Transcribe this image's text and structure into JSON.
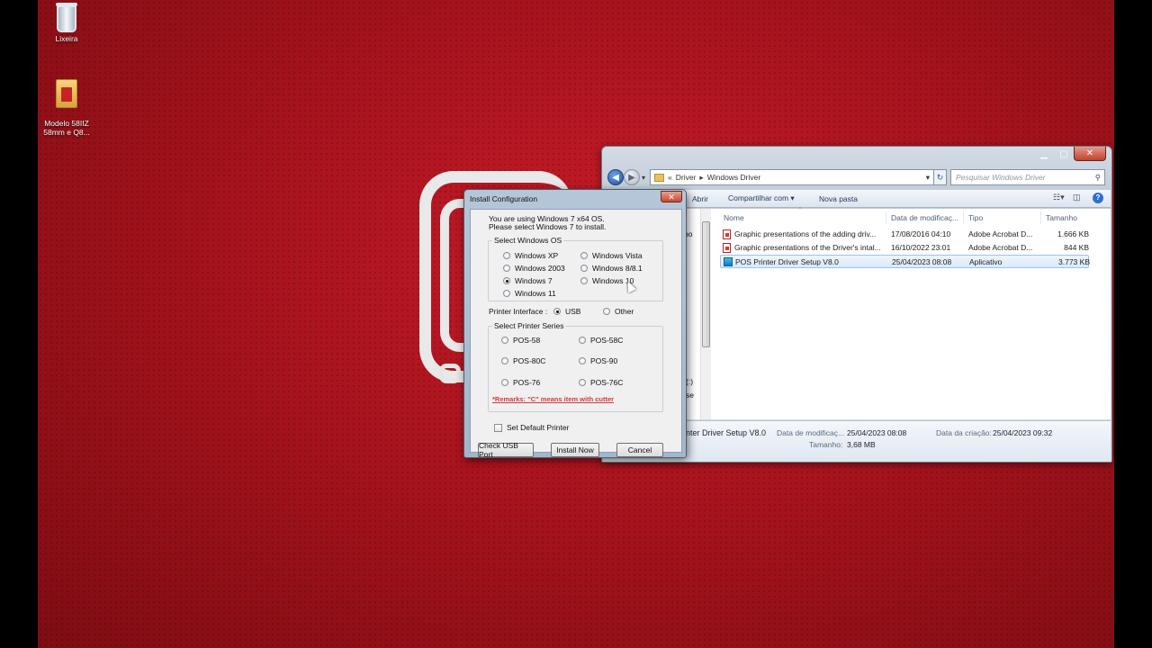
{
  "desktop": {
    "icons": [
      {
        "label": "Lixeira",
        "icon": "recycle-bin-icon"
      },
      {
        "label": "Modelo 58IIZ\n58mm e Q8...",
        "icon": "folder-icon"
      }
    ]
  },
  "explorer": {
    "breadcrumb": {
      "prefix": "«",
      "root": "Driver",
      "sep": "▸",
      "current": "Windows Driver"
    },
    "search_placeholder": "Pesquisar Windows Driver",
    "toolbar": {
      "open": "Abrir",
      "share": "Compartilhar com ▾",
      "new_folder": "Nova pasta",
      "partial_left": "o"
    },
    "columns": {
      "name": "Nome",
      "date": "Data de modificaç...",
      "type": "Tipo",
      "size": "Tamanho"
    },
    "files": [
      {
        "name": "Graphic presentations of the adding driv...",
        "date": "17/08/2016 04:10",
        "type": "Adobe Acrobat D...",
        "size": "1.666 KB",
        "icon": "pdf-icon"
      },
      {
        "name": "Graphic presentations of the Driver's intal...",
        "date": "16/10/2022 23:01",
        "type": "Adobe Acrobat D...",
        "size": "844 KB",
        "icon": "pdf-icon"
      },
      {
        "name": "POS Printer Driver Setup V8.0",
        "date": "25/04/2023 08:08",
        "type": "Aplicativo",
        "size": "3.773 KB",
        "icon": "app-icon"
      }
    ],
    "sidebar_partial": {
      "a": "ho",
      "b": "(:)",
      "c": "se"
    },
    "details": {
      "name": "nter Driver Setup V8.0",
      "mod_label": "Data de modificaç...",
      "mod_value": "25/04/2023 08:08",
      "created_label": "Data da criação:",
      "created_value": "25/04/2023 09:32",
      "size_label": "Tamanho:",
      "size_value": "3,68 MB"
    }
  },
  "dialog": {
    "title": "Install Configuration",
    "close": "✕",
    "info_line1": "You are using Windows 7 x64 OS.",
    "info_line2": "Please select Windows 7 to install.",
    "os_group": "Select Windows OS",
    "os_options": {
      "xp": "Windows XP",
      "vista": "Windows Vista",
      "w2003": "Windows 2003",
      "w8": "Windows 8/8.1",
      "w7": "Windows 7",
      "w10": "Windows 10",
      "w11": "Windows 11"
    },
    "selected_os": "Windows 7",
    "interface_label": "Printer Interface :",
    "interface_usb": "USB",
    "interface_other": "Other",
    "selected_interface": "USB",
    "series_group": "Select Printer Series",
    "series": {
      "p58": "POS-58",
      "p58c": "POS-58C",
      "p80c": "POS-80C",
      "p90": "POS-90",
      "p76": "POS-76",
      "p76c": "POS-76C"
    },
    "remark": "*Remarks: \"C\" means item with cutter",
    "default_printer": "Set Default Printer",
    "default_printer_checked": false,
    "buttons": {
      "check_usb": "Check USB Port",
      "install": "Install Now",
      "cancel": "Cancel"
    }
  },
  "colors": {
    "desktop_red": "#a8131d",
    "selection": "#d9e9fb",
    "remark_red": "#d23a3a"
  }
}
